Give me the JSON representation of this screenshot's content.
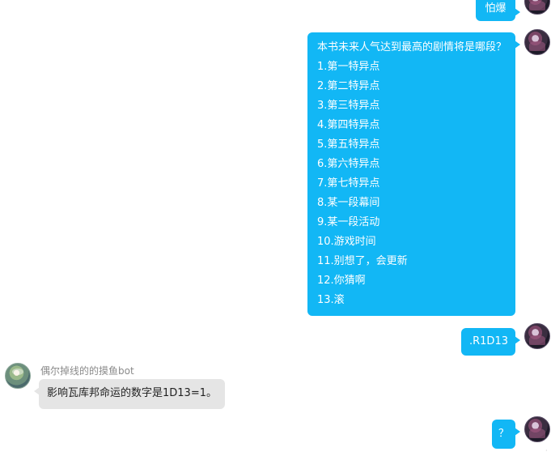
{
  "messages": {
    "msg1": {
      "text": "怕爆"
    },
    "msg2": {
      "title": "本书未来人气达到最高的剧情将是哪段？",
      "options": [
        "1.第一特异点",
        "2.第二特异点",
        "3.第三特异点",
        "4.第四特异点",
        "5.第五特异点",
        "6.第六特异点",
        "7.第七特异点",
        "8.某一段幕间",
        "9.某一段活动",
        "10.游戏时间",
        "11.别想了，会更新",
        "12.你猜啊",
        "13.滚"
      ]
    },
    "msg3": {
      "text": ".R1D13"
    },
    "msg4": {
      "sender": "偶尔掉线的的摸鱼bot",
      "text": "影响瓦库邦命运的数字是1D13=1。"
    },
    "msg5": {
      "text": "？"
    }
  },
  "colors": {
    "outgoing_bubble": "#12b7f5",
    "incoming_bubble": "#e5e5e5",
    "sender_name": "#8a8a8a"
  },
  "icons": {
    "user_avatar": "user-avatar-icon",
    "bot_avatar": "bot-avatar-icon"
  }
}
